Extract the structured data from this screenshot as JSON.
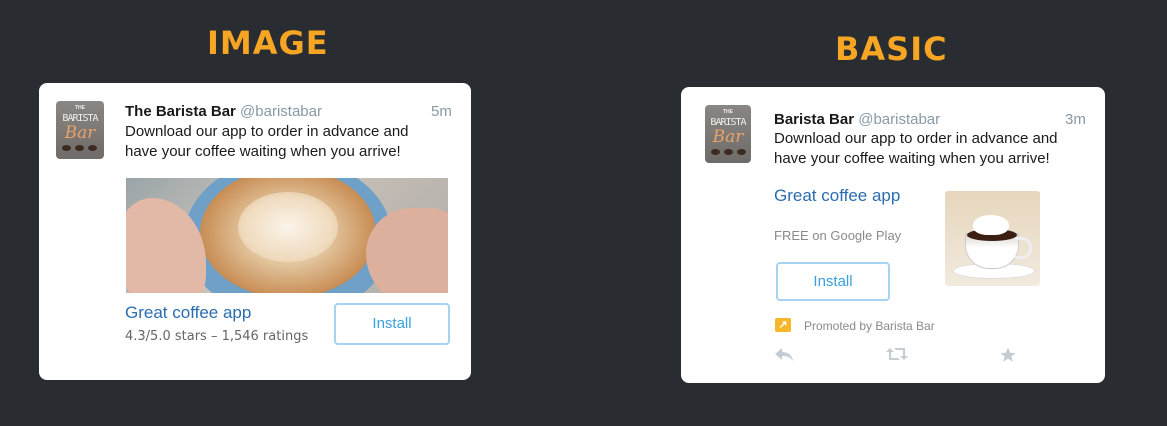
{
  "headings": {
    "image": "IMAGE",
    "basic": "BASIC"
  },
  "cards": {
    "image": {
      "display_name": "The Barista Bar",
      "handle": "@baristabar",
      "time": "5m",
      "text_line1": "Download our app to order in advance and",
      "text_line2": "have your coffee waiting when you arrive!",
      "app_title": "Great coffee app",
      "ratings": "4.3/5.0 stars – 1,546 ratings",
      "install_label": "Install"
    },
    "basic": {
      "display_name": "Barista Bar",
      "handle": "@baristabar",
      "time": "3m",
      "text_line1": "Download our app to order in advance and",
      "text_line2": "have your coffee waiting when you arrive!",
      "app_title": "Great coffee app",
      "price": "FREE on Google Play",
      "install_label": "Install",
      "promoted": "Promoted by Barista Bar"
    }
  },
  "avatar": {
    "the": "THE",
    "barista": "BARISTA",
    "bar": "Bar"
  },
  "icons": {
    "reply": "reply-icon",
    "retweet": "retweet-icon",
    "favorite": "star-icon",
    "promoted": "promoted-arrow-icon"
  },
  "colors": {
    "background": "#292c30",
    "heading": "#f6a623",
    "link": "#2b6cb0",
    "install_border": "#a7d3f0",
    "install_text": "#3aa0e0",
    "muted": "#8899a6",
    "promo_badge": "#f6b82a"
  }
}
